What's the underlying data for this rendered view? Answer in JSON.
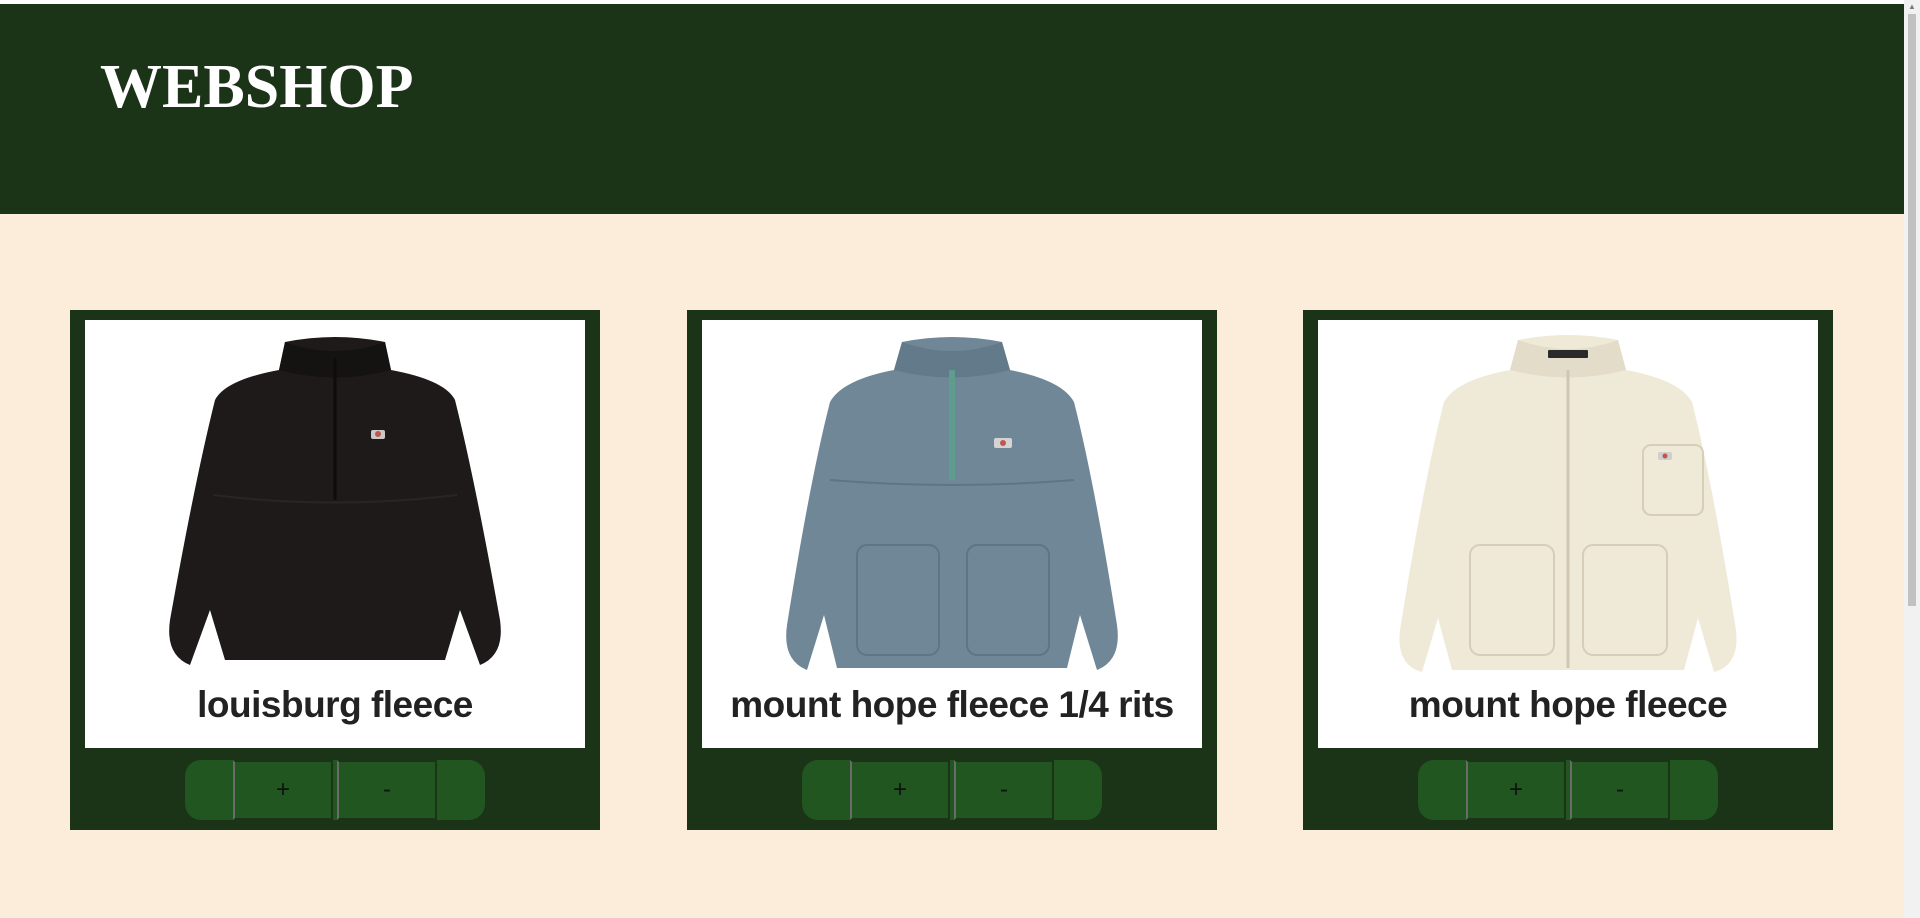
{
  "header": {
    "logo": "WEBSHOP"
  },
  "colors": {
    "header_bg": "#1b3418",
    "page_bg": "#fcedda",
    "button_bg": "#215620"
  },
  "products": [
    {
      "name": "louisburg fleece",
      "image_icon": "black-half-zip-fleece",
      "plus_label": "+",
      "minus_label": "-"
    },
    {
      "name": "mount hope fleece 1/4 rits",
      "image_icon": "blue-grey-quarter-zip-fleece",
      "plus_label": "+",
      "minus_label": "-"
    },
    {
      "name": "mount hope fleece",
      "image_icon": "cream-full-zip-fleece",
      "plus_label": "+",
      "minus_label": "-"
    }
  ]
}
